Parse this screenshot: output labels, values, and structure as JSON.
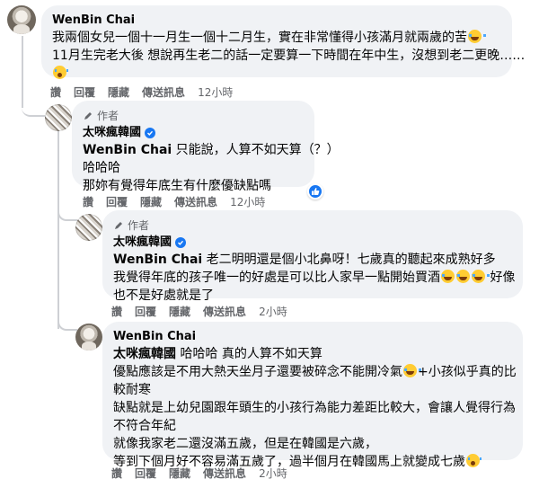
{
  "actions": {
    "like": "讚",
    "reply": "回覆",
    "hide": "隱藏",
    "message": "傳送訊息"
  },
  "author_badge": "作者",
  "comments": [
    {
      "name": "WenBin Chai",
      "lines": [
        "我兩個女兒一個十一月生一個十二月生，實在非常懂得小孩滿月就兩歲的苦",
        "11月生完老大後 想說再生老二的話一定要算一下時間在年中生，沒想到老二更晚……"
      ],
      "time": "12小時"
    },
    {
      "name": "太咪瘋韓國",
      "mention": "WenBin Chai",
      "first_line": " 只能說，人算不如天算（？）",
      "lines": [
        "哈哈哈",
        "那妳有覺得年底生有什麼優缺點嗎"
      ],
      "time": "12小時"
    },
    {
      "name": "太咪瘋韓國",
      "mention": "WenBin Chai",
      "first_line": " 老二明明還是個小北鼻呀！七歲真的聽起來成熟好多",
      "line2": "我覺得年底的孩子唯一的好處是可以比人家早一點開始買酒",
      "line2_tail": " 好像",
      "line3": "也不是好處就是了",
      "time": "2小時"
    },
    {
      "name": "WenBin Chai",
      "mention": "太咪瘋韓國",
      "first_line": " 哈哈哈 真的人算不如天算",
      "line2a": "優點應該是不用大熱天坐月子還要被碎念不能開冷氣",
      "line2b": "+小孩似乎真的比",
      "lines": [
        "較耐寒",
        "缺點就是上幼兒園跟年頭生的小孩行為能力差距比較大，會讓人覺得行為",
        "不符合年紀",
        "就像我家老二還沒滿五歲，但是在韓國是六歲，"
      ],
      "last_line": "等到下個月好不容易滿五歲了，過半個月在韓國馬上就變成七歲",
      "time": "2小時"
    }
  ]
}
